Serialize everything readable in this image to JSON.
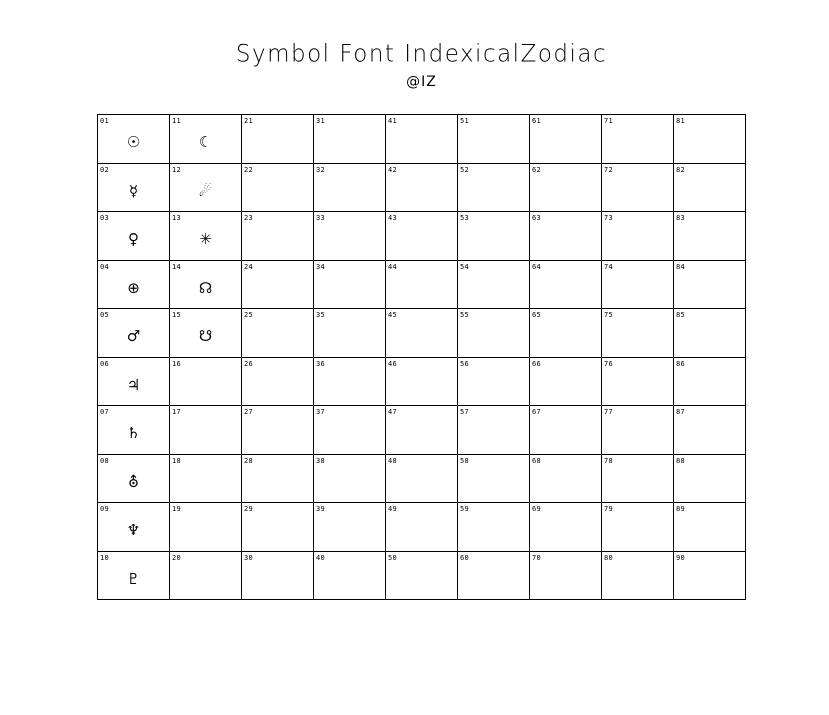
{
  "title": "Symbol Font IndexicalZodiac",
  "subtitle": "@IZ",
  "cells": [
    {
      "code": "01",
      "glyph": "☉",
      "glyph_name": "sun"
    },
    {
      "code": "11",
      "glyph": "☾",
      "glyph_name": "moon"
    },
    {
      "code": "21",
      "glyph": ""
    },
    {
      "code": "31",
      "glyph": ""
    },
    {
      "code": "41",
      "glyph": ""
    },
    {
      "code": "51",
      "glyph": ""
    },
    {
      "code": "61",
      "glyph": ""
    },
    {
      "code": "71",
      "glyph": ""
    },
    {
      "code": "81",
      "glyph": ""
    },
    {
      "code": "02",
      "glyph": "☿",
      "glyph_name": "mercury"
    },
    {
      "code": "12",
      "glyph": "☄",
      "glyph_name": "comet"
    },
    {
      "code": "22",
      "glyph": ""
    },
    {
      "code": "32",
      "glyph": ""
    },
    {
      "code": "42",
      "glyph": ""
    },
    {
      "code": "52",
      "glyph": ""
    },
    {
      "code": "62",
      "glyph": ""
    },
    {
      "code": "72",
      "glyph": ""
    },
    {
      "code": "82",
      "glyph": ""
    },
    {
      "code": "03",
      "glyph": "♀",
      "glyph_name": "venus"
    },
    {
      "code": "13",
      "glyph": "✳",
      "glyph_name": "star"
    },
    {
      "code": "23",
      "glyph": ""
    },
    {
      "code": "33",
      "glyph": ""
    },
    {
      "code": "43",
      "glyph": ""
    },
    {
      "code": "53",
      "glyph": ""
    },
    {
      "code": "63",
      "glyph": ""
    },
    {
      "code": "73",
      "glyph": ""
    },
    {
      "code": "83",
      "glyph": ""
    },
    {
      "code": "04",
      "glyph": "⊕",
      "glyph_name": "earth"
    },
    {
      "code": "14",
      "glyph": "☊",
      "glyph_name": "ascending-node"
    },
    {
      "code": "24",
      "glyph": ""
    },
    {
      "code": "34",
      "glyph": ""
    },
    {
      "code": "44",
      "glyph": ""
    },
    {
      "code": "54",
      "glyph": ""
    },
    {
      "code": "64",
      "glyph": ""
    },
    {
      "code": "74",
      "glyph": ""
    },
    {
      "code": "84",
      "glyph": ""
    },
    {
      "code": "05",
      "glyph": "♂",
      "glyph_name": "mars"
    },
    {
      "code": "15",
      "glyph": "☋",
      "glyph_name": "descending-node"
    },
    {
      "code": "25",
      "glyph": ""
    },
    {
      "code": "35",
      "glyph": ""
    },
    {
      "code": "45",
      "glyph": ""
    },
    {
      "code": "55",
      "glyph": ""
    },
    {
      "code": "65",
      "glyph": ""
    },
    {
      "code": "75",
      "glyph": ""
    },
    {
      "code": "85",
      "glyph": ""
    },
    {
      "code": "06",
      "glyph": "♃",
      "glyph_name": "jupiter"
    },
    {
      "code": "16",
      "glyph": ""
    },
    {
      "code": "26",
      "glyph": ""
    },
    {
      "code": "36",
      "glyph": ""
    },
    {
      "code": "46",
      "glyph": ""
    },
    {
      "code": "56",
      "glyph": ""
    },
    {
      "code": "66",
      "glyph": ""
    },
    {
      "code": "76",
      "glyph": ""
    },
    {
      "code": "86",
      "glyph": ""
    },
    {
      "code": "07",
      "glyph": "♄",
      "glyph_name": "saturn"
    },
    {
      "code": "17",
      "glyph": ""
    },
    {
      "code": "27",
      "glyph": ""
    },
    {
      "code": "37",
      "glyph": ""
    },
    {
      "code": "47",
      "glyph": ""
    },
    {
      "code": "57",
      "glyph": ""
    },
    {
      "code": "67",
      "glyph": ""
    },
    {
      "code": "77",
      "glyph": ""
    },
    {
      "code": "87",
      "glyph": ""
    },
    {
      "code": "08",
      "glyph": "⛢",
      "glyph_name": "uranus"
    },
    {
      "code": "18",
      "glyph": ""
    },
    {
      "code": "28",
      "glyph": ""
    },
    {
      "code": "38",
      "glyph": ""
    },
    {
      "code": "48",
      "glyph": ""
    },
    {
      "code": "58",
      "glyph": ""
    },
    {
      "code": "68",
      "glyph": ""
    },
    {
      "code": "78",
      "glyph": ""
    },
    {
      "code": "88",
      "glyph": ""
    },
    {
      "code": "09",
      "glyph": "♆",
      "glyph_name": "neptune"
    },
    {
      "code": "19",
      "glyph": ""
    },
    {
      "code": "29",
      "glyph": ""
    },
    {
      "code": "39",
      "glyph": ""
    },
    {
      "code": "49",
      "glyph": ""
    },
    {
      "code": "59",
      "glyph": ""
    },
    {
      "code": "69",
      "glyph": ""
    },
    {
      "code": "79",
      "glyph": ""
    },
    {
      "code": "89",
      "glyph": ""
    },
    {
      "code": "10",
      "glyph": "♇",
      "glyph_name": "pluto"
    },
    {
      "code": "20",
      "glyph": ""
    },
    {
      "code": "30",
      "glyph": ""
    },
    {
      "code": "40",
      "glyph": ""
    },
    {
      "code": "50",
      "glyph": ""
    },
    {
      "code": "60",
      "glyph": ""
    },
    {
      "code": "70",
      "glyph": ""
    },
    {
      "code": "80",
      "glyph": ""
    },
    {
      "code": "90",
      "glyph": ""
    }
  ]
}
